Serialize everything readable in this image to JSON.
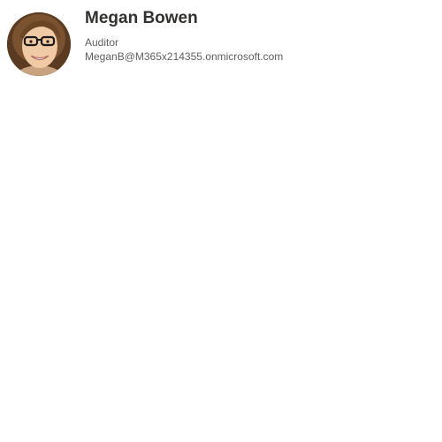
{
  "person": {
    "name": "Megan Bowen",
    "job_title": "Auditor",
    "email": "MeganB@M365x214355.onmicrosoft.com",
    "avatar_icon": "person-photo"
  },
  "colors": {
    "name_text": "#323130",
    "secondary_text": "#605e5c",
    "background": "#ffffff"
  }
}
